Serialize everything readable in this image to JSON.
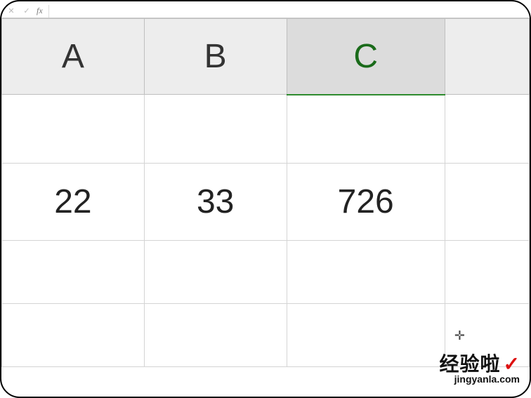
{
  "formula_bar": {
    "cancel": "✕",
    "confirm": "✓",
    "fx_label": "fx",
    "value": ""
  },
  "columns": [
    "A",
    "B",
    "C",
    ""
  ],
  "active_column_index": 2,
  "rows": [
    [
      "",
      "",
      "",
      ""
    ],
    [
      "22",
      "33",
      "726",
      ""
    ],
    [
      "",
      "",
      "",
      ""
    ],
    [
      "",
      "",
      "",
      ""
    ]
  ],
  "selection": {
    "row": 3,
    "col": 2
  },
  "watermark": {
    "main": "经验啦",
    "check": "✓",
    "sub": "jingyanla.com"
  },
  "cursor_glyph": "✛",
  "chart_data": {
    "type": "table",
    "columns": [
      "A",
      "B",
      "C"
    ],
    "rows": [
      {
        "A": "",
        "B": "",
        "C": ""
      },
      {
        "A": 22,
        "B": 33,
        "C": 726
      },
      {
        "A": "",
        "B": "",
        "C": ""
      }
    ],
    "title": "",
    "xlabel": "",
    "ylabel": ""
  }
}
